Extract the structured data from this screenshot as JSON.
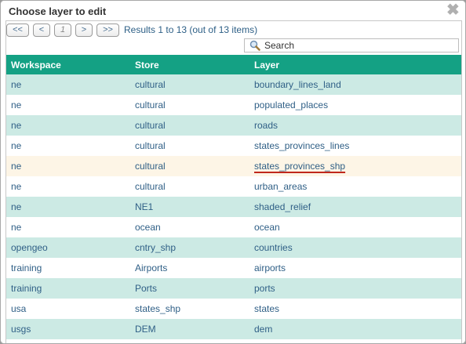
{
  "dialog": {
    "title": "Choose layer to edit",
    "close_glyph": "✖"
  },
  "pager": {
    "first": "<<",
    "prev": "<",
    "current": "1",
    "next": ">",
    "last": ">>",
    "info": "Results 1 to 13 (out of 13 items)"
  },
  "search": {
    "placeholder": "Search",
    "value": ""
  },
  "table": {
    "headers": [
      "Workspace",
      "Store",
      "Layer"
    ],
    "rows": [
      {
        "workspace": "ne",
        "store": "cultural",
        "layer": "boundary_lines_land"
      },
      {
        "workspace": "ne",
        "store": "cultural",
        "layer": "populated_places"
      },
      {
        "workspace": "ne",
        "store": "cultural",
        "layer": "roads"
      },
      {
        "workspace": "ne",
        "store": "cultural",
        "layer": "states_provinces_lines"
      },
      {
        "workspace": "ne",
        "store": "cultural",
        "layer": "states_provinces_shp"
      },
      {
        "workspace": "ne",
        "store": "cultural",
        "layer": "urban_areas"
      },
      {
        "workspace": "ne",
        "store": "NE1",
        "layer": "shaded_relief"
      },
      {
        "workspace": "ne",
        "store": "ocean",
        "layer": "ocean"
      },
      {
        "workspace": "opengeo",
        "store": "cntry_shp",
        "layer": "countries"
      },
      {
        "workspace": "training",
        "store": "Airports",
        "layer": "airports"
      },
      {
        "workspace": "training",
        "store": "Ports",
        "layer": "ports"
      },
      {
        "workspace": "usa",
        "store": "states_shp",
        "layer": "states"
      },
      {
        "workspace": "usgs",
        "store": "DEM",
        "layer": "dem"
      }
    ]
  },
  "colors": {
    "header_bg": "#14a184",
    "row_alt": "#cceae4",
    "row_hover": "#fdf5e6",
    "link": "#2f5f86",
    "hover_underline": "#c0281c"
  }
}
